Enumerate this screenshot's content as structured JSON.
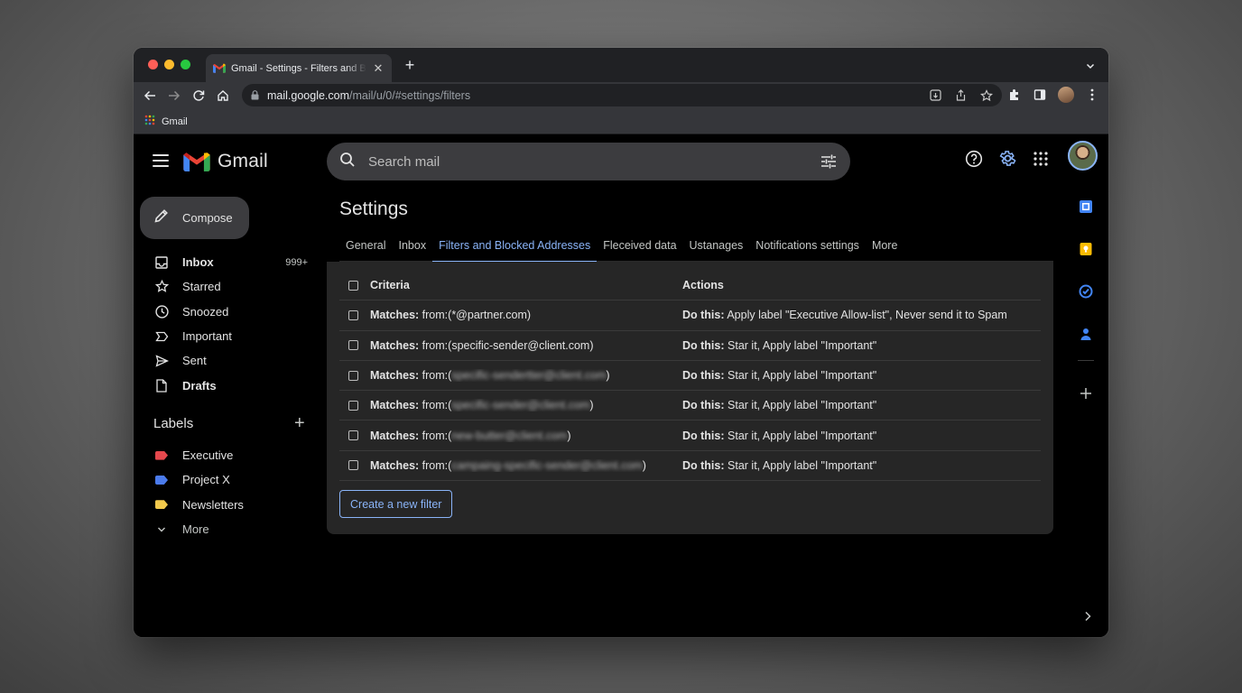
{
  "browser": {
    "tab_title": "Gmail - Settings - Filters and Blocked Addresses",
    "url_host": "mail.google.com",
    "url_path": "/mail/u/0/#settings/filters",
    "bookmark_label": "Gmail"
  },
  "header": {
    "logo_text": "Gmail",
    "search_placeholder": "Search mail"
  },
  "sidebar": {
    "compose_label": "Compose",
    "items": [
      {
        "label": "Inbox",
        "count": "999+",
        "icon": "inbox-icon"
      },
      {
        "label": "Starred",
        "icon": "star-icon"
      },
      {
        "label": "Snoozed",
        "icon": "clock-icon"
      },
      {
        "label": "Important",
        "icon": "important-icon"
      },
      {
        "label": "Sent",
        "icon": "send-icon"
      },
      {
        "label": "Drafts",
        "icon": "draft-icon"
      }
    ],
    "labels_heading": "Labels",
    "labels": [
      {
        "label": "Executive",
        "color": "#e5484d"
      },
      {
        "label": "Project X",
        "color": "#4b7bec"
      },
      {
        "label": "Newsletters",
        "color": "#f2c94c"
      }
    ],
    "more_label": "More"
  },
  "settings": {
    "title": "Settings",
    "tabs": [
      "General",
      "Inbox",
      "Filters and Blocked Addresses",
      "Fleceived data",
      "Ustanages",
      "Notifications settings",
      "More"
    ],
    "active_tab": "Filters and Blocked Addresses",
    "table": {
      "headers": {
        "criteria": "Criteria",
        "actions": "Actions"
      },
      "match_prefix": "Matches:",
      "action_prefix": "Do this:",
      "rows": [
        {
          "from_open": "from:(",
          "address": "*@partner.com",
          "from_close": ")",
          "blurred": false,
          "action": "Apply label \"Executive Allow-list\", Never send it to Spam"
        },
        {
          "from_open": "from:(",
          "address": "specific-sender@client.com",
          "from_close": ")",
          "blurred": false,
          "action": "Star it, Apply label \"Important\""
        },
        {
          "from_open": "from:(",
          "address": "specific-sendertter@client.com",
          "from_close": ")",
          "blurred": true,
          "action": "Star it, Apply label \"Important\""
        },
        {
          "from_open": "from:(",
          "address": "specific-sender@client.com",
          "from_close": ")",
          "blurred": true,
          "action": "Star it, Apply label \"Important\""
        },
        {
          "from_open": "from:(",
          "address": "new-butter@client.com",
          "from_close": ")",
          "blurred": true,
          "action": "Star it, Apply label \"Important\""
        },
        {
          "from_open": "from:(",
          "address": "campaing-specific-sender@client.com",
          "from_close": ")",
          "blurred": true,
          "action": "Star it, Apply label \"Important\""
        }
      ]
    },
    "create_filter_label": "Create a new filter"
  },
  "colors": {
    "accent": "#8ab4f8",
    "background": "#000000",
    "panel": "#262626"
  }
}
